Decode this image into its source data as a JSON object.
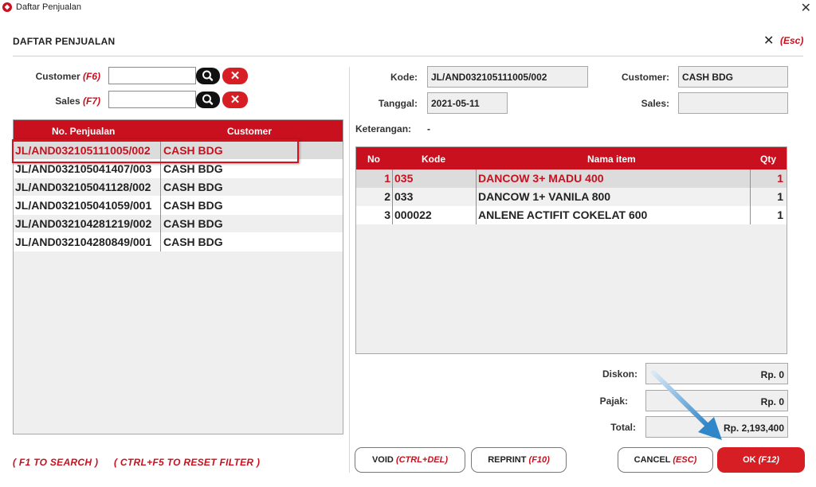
{
  "window": {
    "title": "Daftar Penjualan",
    "close_glyph": "✕",
    "icon_glyph": "◆"
  },
  "header": {
    "title": "DAFTAR PENJUALAN",
    "close_glyph": "✕",
    "esc_hint": "(Esc)"
  },
  "filters": {
    "customer": {
      "label": "Customer",
      "key": "(F6)",
      "value": ""
    },
    "sales": {
      "label": "Sales",
      "key": "(F7)",
      "value": ""
    },
    "clear_glyph": "✕"
  },
  "sales_list": {
    "columns": [
      "No. Penjualan",
      "Customer"
    ],
    "rows": [
      {
        "no": "JL/AND032105111005/002",
        "customer": "CASH BDG"
      },
      {
        "no": "JL/AND032105041407/003",
        "customer": "CASH BDG"
      },
      {
        "no": "JL/AND032105041128/002",
        "customer": "CASH BDG"
      },
      {
        "no": "JL/AND032105041059/001",
        "customer": "CASH BDG"
      },
      {
        "no": "JL/AND032104281219/002",
        "customer": "CASH BDG"
      },
      {
        "no": "JL/AND032104280849/001",
        "customer": "CASH BDG"
      }
    ],
    "selected_index": 0
  },
  "footer_hints": {
    "search": "( F1 TO SEARCH )",
    "reset": "( CTRL+F5 TO RESET FILTER )"
  },
  "detail": {
    "kode_label": "Kode:",
    "kode_value": "JL/AND032105111005/002",
    "customer_label": "Customer:",
    "customer_value": "CASH BDG",
    "tanggal_label": "Tanggal:",
    "tanggal_value": "2021-05-11",
    "sales_label": "Sales:",
    "sales_value": "",
    "keterangan_label": "Keterangan:",
    "keterangan_value": "-"
  },
  "items": {
    "columns": [
      "No",
      "Kode",
      "Nama item",
      "Qty"
    ],
    "rows": [
      {
        "no": "1",
        "kode": "035",
        "nama": "DANCOW 3+ MADU 400",
        "qty": "1"
      },
      {
        "no": "2",
        "kode": "033",
        "nama": "DANCOW 1+ VANILA 800",
        "qty": "1"
      },
      {
        "no": "3",
        "kode": "000022",
        "nama": "ANLENE ACTIFIT COKELAT 600",
        "qty": "1"
      }
    ],
    "selected_index": 0
  },
  "summary": {
    "diskon_label": "Diskon:",
    "diskon_value": "Rp. 0",
    "pajak_label": "Pajak:",
    "pajak_value": "Rp. 0",
    "total_label": "Total:",
    "total_value": "Rp. 2,193,400"
  },
  "buttons": {
    "void": {
      "label": "VOID",
      "key": "(CTRL+DEL)"
    },
    "reprint": {
      "label": "REPRINT",
      "key": "(F10)"
    },
    "cancel": {
      "label": "CANCEL",
      "key": "(ESC)"
    },
    "ok": {
      "label": "OK",
      "key": "(F12)"
    }
  },
  "colors": {
    "accent": "#c8101e",
    "arrow": "#2f86c8"
  }
}
